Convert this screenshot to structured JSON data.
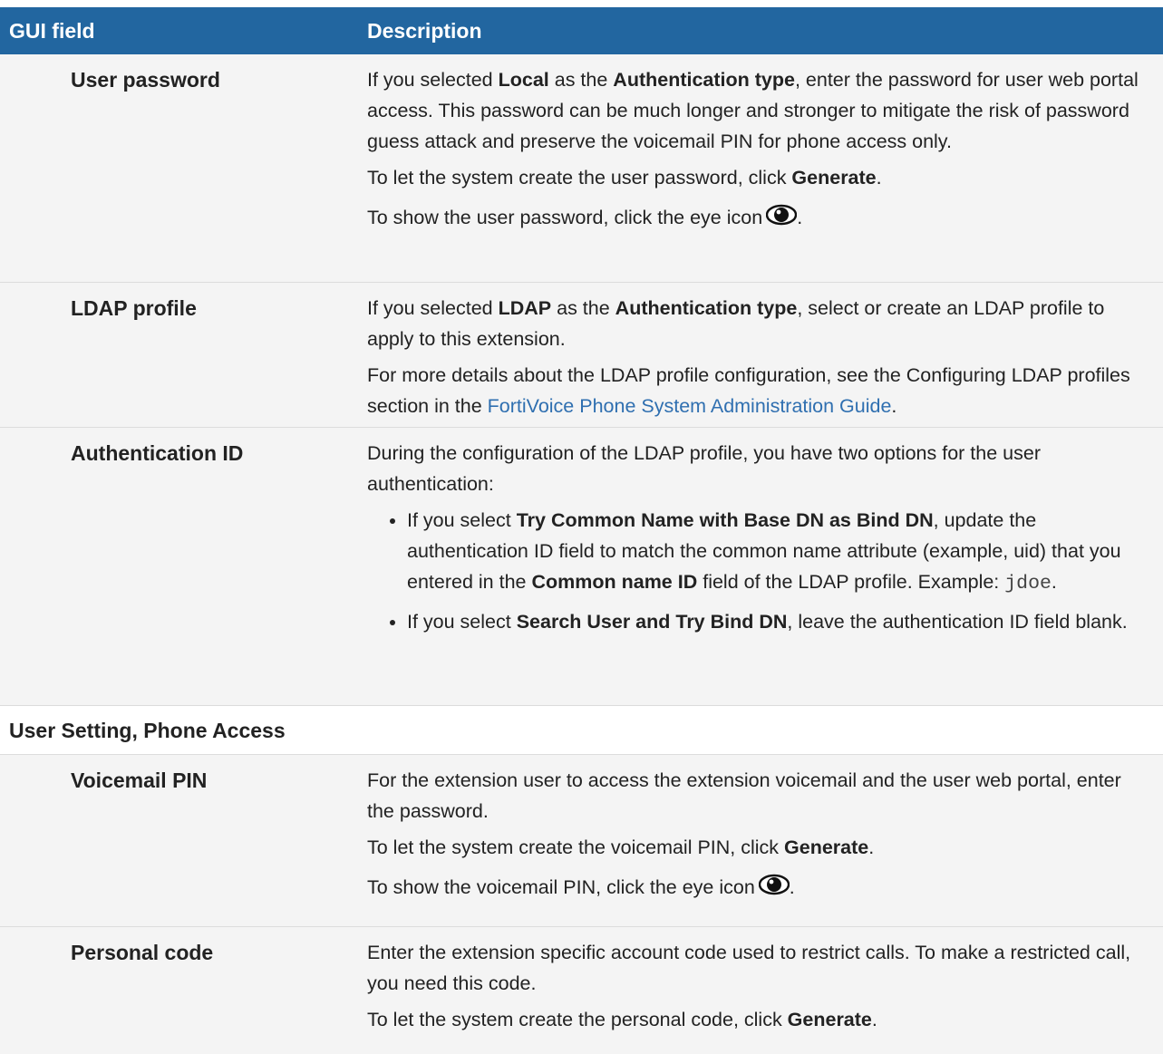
{
  "colors": {
    "header_bg": "#2266a0",
    "link": "#2f6fb0",
    "row_shade": "#f4f4f4"
  },
  "header": {
    "col1": "GUI field",
    "col2": "Description"
  },
  "rows": {
    "user_password": {
      "field": "User password",
      "p1": [
        "If you selected ",
        "Local",
        " as the ",
        "Authentication type",
        ", enter the password for user web portal access. This password can be much longer and stronger to mitigate the risk of password guess attack and preserve the voicemail PIN for phone access only."
      ],
      "p2": [
        "To let the system create the user password, click ",
        "Generate",
        "."
      ],
      "p3": [
        "To show the user password, click the eye icon",
        "."
      ]
    },
    "ldap_profile": {
      "field": "LDAP profile",
      "p1": [
        "If you selected ",
        "LDAP",
        " as the ",
        "Authentication type",
        ", select or create an LDAP profile to apply to this extension."
      ],
      "p2": [
        "For more details about the LDAP profile configuration, see the Configuring LDAP profiles section in the ",
        "FortiVoice Phone System Administration Guide",
        "."
      ]
    },
    "authentication_id": {
      "field": "Authentication ID",
      "intro": "During the configuration of the LDAP profile, you have two options for the user authentication:",
      "b1": [
        "If you select ",
        "Try Common Name with Base DN as Bind DN",
        ", update the authentication ID field to match the common name attribute (example, uid) that you entered in the ",
        "Common name ID",
        " field of the LDAP profile. Example: ",
        "jdoe",
        "."
      ],
      "b2": [
        "If you select ",
        "Search User and Try Bind DN",
        ", leave the authentication ID field blank."
      ]
    },
    "section_title": "User Setting, Phone Access",
    "voicemail_pin": {
      "field": "Voicemail PIN",
      "p1": "For the extension user to access the extension voicemail and the user web portal, enter the password.",
      "p2": [
        "To let the system create the voicemail PIN, click ",
        "Generate",
        "."
      ],
      "p3": [
        "To show the voicemail PIN, click the eye icon",
        "."
      ]
    },
    "personal_code": {
      "field": "Personal code",
      "p1": "Enter the extension specific account code used to restrict calls. To make a restricted call, you need this code.",
      "p2": [
        "To let the system create the personal code, click ",
        "Generate",
        "."
      ]
    }
  }
}
